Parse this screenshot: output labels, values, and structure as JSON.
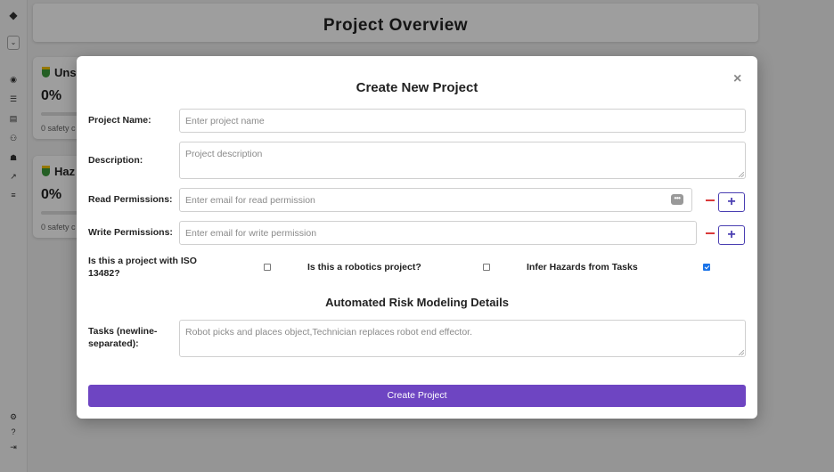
{
  "app": {
    "page_title": "Project Overview",
    "sidebar_icons": [
      "logo-icon",
      "dashboard-icon",
      "list-icon",
      "document-icon",
      "diagram-icon",
      "robot-icon",
      "chart-icon",
      "database-icon",
      "settings-icon",
      "help-icon",
      "logout-icon"
    ],
    "cards": [
      {
        "title": "Uns",
        "percent": "0%",
        "subtitle": "0 safety c"
      },
      {
        "title": "Haz",
        "percent": "0%",
        "subtitle": "0 safety c"
      }
    ]
  },
  "modal": {
    "title": "Create New Project",
    "close_label": "×",
    "project_name": {
      "label": "Project Name:",
      "placeholder": "Enter project name",
      "value": ""
    },
    "description": {
      "label": "Description:",
      "placeholder": "Project description",
      "value": ""
    },
    "read_permissions": {
      "label": "Read Permissions:",
      "placeholder": "Enter email for read permission",
      "value": ""
    },
    "write_permissions": {
      "label": "Write Permissions:",
      "placeholder": "Enter email for write permission",
      "value": ""
    },
    "add_label": "+",
    "iso_checkbox": {
      "label_line1": "Is this a project with ISO",
      "label_line2": "13482?",
      "checked": false
    },
    "robotics_checkbox": {
      "label": "Is this a robotics project?",
      "checked": false
    },
    "infer_checkbox": {
      "label": "Infer Hazards from Tasks",
      "checked": true
    },
    "section_title": "Automated Risk Modeling Details",
    "tasks": {
      "label_line1": "Tasks (newline-",
      "label_line2": "separated):",
      "placeholder": "Robot picks and places object,Technician replaces robot end effector.",
      "value": ""
    },
    "submit_label": "Create Project"
  },
  "colors": {
    "primary": "#6e45c2",
    "remove": "#d93a3a",
    "add_border": "#4a3fb2",
    "checkbox_checked": "#1a73e8"
  }
}
